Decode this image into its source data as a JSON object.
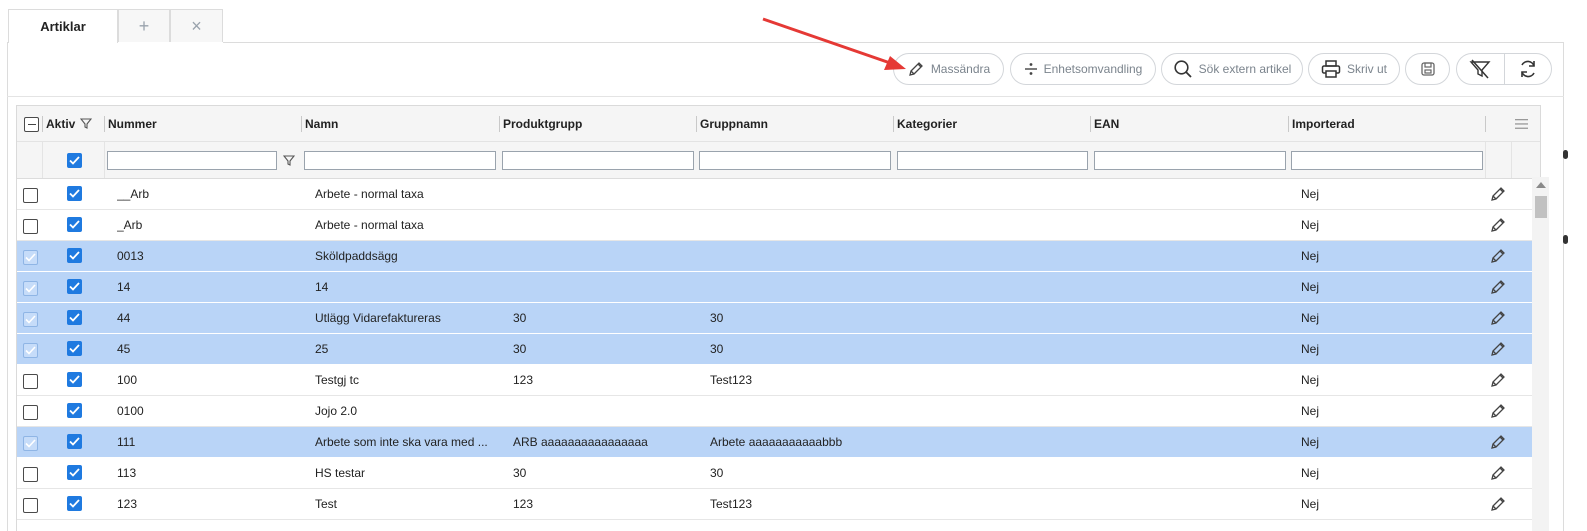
{
  "tabs": {
    "active_label": "Artiklar",
    "add_symbol": "+",
    "close_symbol": "×"
  },
  "toolbar": {
    "mass_edit_label": "Massändra",
    "unit_conversion_label": "Enhetsomvandling",
    "search_external_label": "Sök extern artikel",
    "print_label": "Skriv ut",
    "icons": [
      "pencil-icon",
      "divide-icon",
      "search-icon",
      "printer-icon",
      "save-icon",
      "filter-clear-icon",
      "refresh-icon"
    ]
  },
  "grid": {
    "headers": {
      "active": "Aktiv",
      "number": "Nummer",
      "name": "Namn",
      "product_group": "Produktgrupp",
      "group_name": "Gruppnamn",
      "categories": "Kategorier",
      "ean": "EAN",
      "imported": "Importerad"
    },
    "rows": [
      {
        "selected": false,
        "active": true,
        "number": "__Arb",
        "name": "Arbete - normal taxa",
        "product_group": "",
        "group_name": "",
        "categories": "",
        "ean": "",
        "imported": "Nej"
      },
      {
        "selected": false,
        "active": true,
        "number": "_Arb",
        "name": "Arbete - normal taxa",
        "product_group": "",
        "group_name": "",
        "categories": "",
        "ean": "",
        "imported": "Nej"
      },
      {
        "selected": true,
        "active": true,
        "number": "0013",
        "name": "Sköldpaddsägg",
        "product_group": "",
        "group_name": "",
        "categories": "",
        "ean": "",
        "imported": "Nej"
      },
      {
        "selected": true,
        "active": true,
        "number": "14",
        "name": "14",
        "product_group": "",
        "group_name": "",
        "categories": "",
        "ean": "",
        "imported": "Nej"
      },
      {
        "selected": true,
        "active": true,
        "number": "44",
        "name": "Utlägg Vidarefaktureras",
        "product_group": "30",
        "group_name": "30",
        "categories": "",
        "ean": "",
        "imported": "Nej"
      },
      {
        "selected": true,
        "active": true,
        "number": "45",
        "name": "25",
        "product_group": "30",
        "group_name": "30",
        "categories": "",
        "ean": "",
        "imported": "Nej"
      },
      {
        "selected": false,
        "active": true,
        "number": "100",
        "name": "Testgj tc",
        "product_group": "123",
        "group_name": "Test123",
        "categories": "",
        "ean": "",
        "imported": "Nej"
      },
      {
        "selected": false,
        "active": true,
        "number": "0100",
        "name": "Jojo 2.0",
        "product_group": "",
        "group_name": "",
        "categories": "",
        "ean": "",
        "imported": "Nej"
      },
      {
        "selected": true,
        "active": true,
        "number": "111",
        "name": "Arbete som inte ska vara med ...",
        "product_group": "ARB aaaaaaaaaaaaaaaa",
        "group_name": "Arbete aaaaaaaaaaabbb",
        "categories": "",
        "ean": "",
        "imported": "Nej"
      },
      {
        "selected": false,
        "active": true,
        "number": "113",
        "name": "HS testar",
        "product_group": "30",
        "group_name": "30",
        "categories": "",
        "ean": "",
        "imported": "Nej"
      },
      {
        "selected": false,
        "active": true,
        "number": "123",
        "name": "Test",
        "product_group": "123",
        "group_name": "Test123",
        "categories": "",
        "ean": "",
        "imported": "Nej"
      }
    ]
  },
  "colors": {
    "selected_row": "#b9d4f7",
    "checkbox_blue": "#1f7ae0",
    "annotation_arrow": "#e53935"
  }
}
